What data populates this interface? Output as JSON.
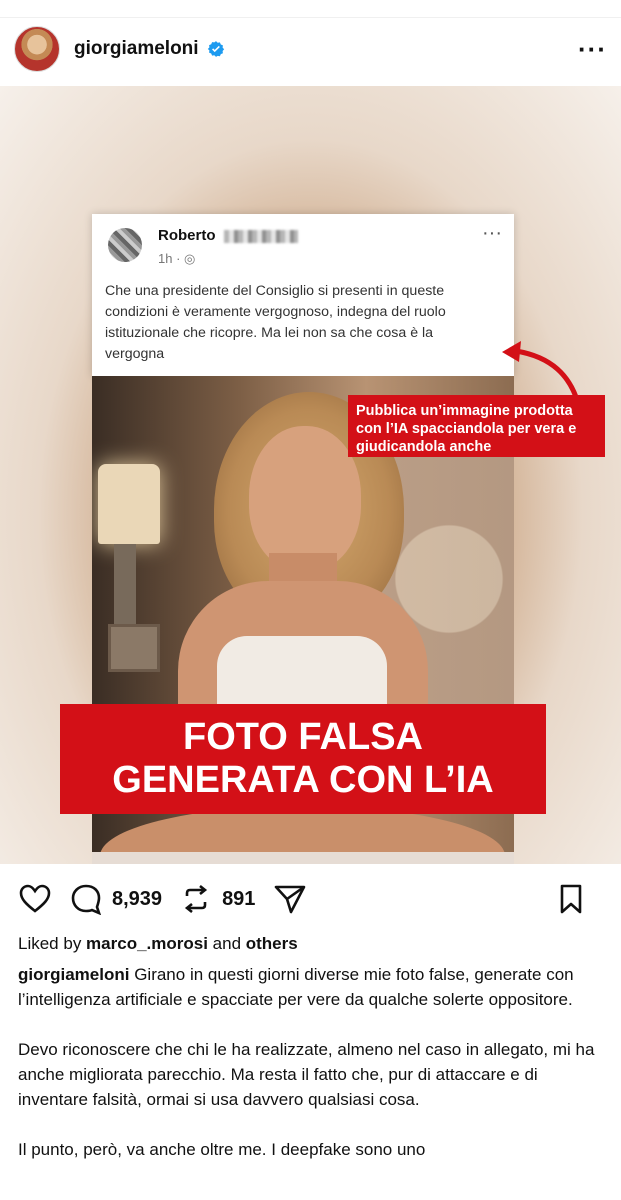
{
  "post": {
    "username": "giorgiameloni",
    "liked_by_prefix": "Liked by ",
    "liked_by_user": "marco_.morosi",
    "liked_by_and": " and ",
    "liked_by_others": "others",
    "comments_count": "8,939",
    "reposts_count": "891",
    "caption_user": "giorgiameloni",
    "caption_p1": " Girano in questi giorni diverse mie foto false, generate con l’intelligenza artificiale e spacciate per vere da qualche solerte oppositore.",
    "caption_p2": "Devo riconoscere che chi le ha realizzate, almeno nel caso in allegato, mi ha anche migliorata parecchio. Ma resta il fatto che, pur di attaccare e di inventare falsità, ormai si usa davvero qualsiasi cosa.",
    "caption_p3": "Il punto, però, va anche oltre me. I deepfake sono uno"
  },
  "media": {
    "fb_name": "Roberto",
    "fb_meta": "1h · ◎",
    "fb_text": "Che una presidente del Consiglio  si presenti in queste condizioni è veramente vergognoso, indegna del ruolo istituzionale che ricopre. Ma lei non sa che cosa è la vergogna",
    "callout_text": "Pubblica un’immagine prodotta con l’IA spacciandola per vera e giudicandola anche",
    "banner_line1": "FOTO FALSA",
    "banner_line2": "GENERATA CON L’IA"
  },
  "ui": {
    "more_label": "···",
    "fb_more_label": "···"
  },
  "icons": {
    "verified": "verified-badge-icon",
    "like": "heart-icon",
    "comment": "comment-bubble-icon",
    "repost": "repost-icon",
    "share": "send-icon",
    "save": "bookmark-icon"
  },
  "colors": {
    "accent_red": "#d31017",
    "verified_blue": "#1d9bf0"
  }
}
